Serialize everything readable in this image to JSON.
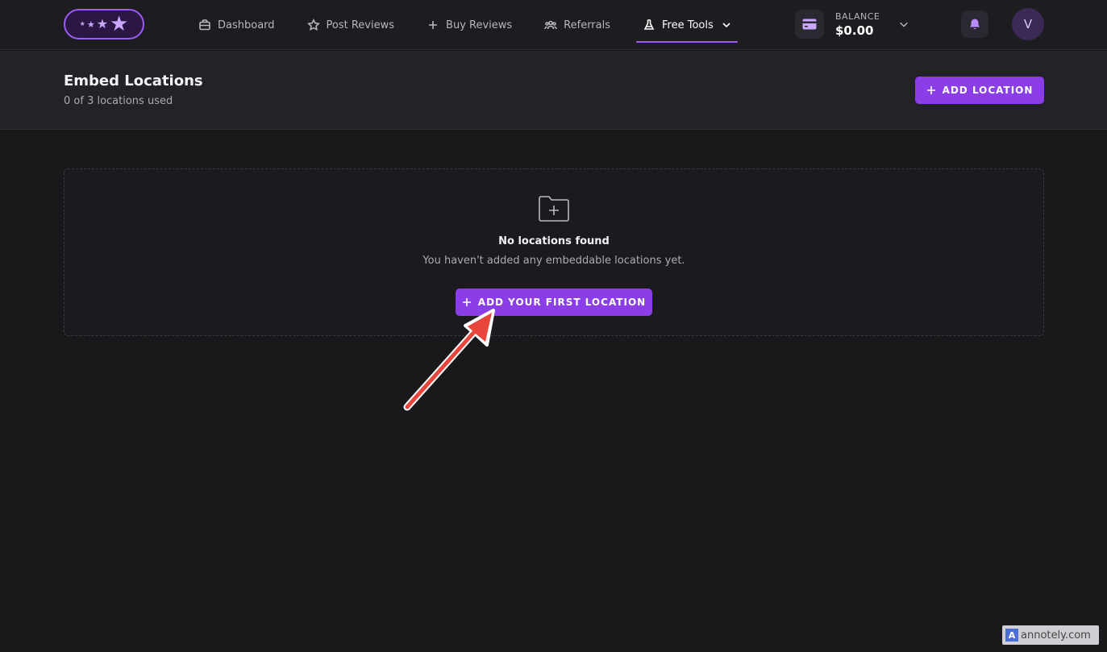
{
  "nav": {
    "items": [
      {
        "label": "Dashboard",
        "icon": "briefcase-icon"
      },
      {
        "label": "Post Reviews",
        "icon": "star-icon"
      },
      {
        "label": "Buy Reviews",
        "icon": "plus-icon"
      },
      {
        "label": "Referrals",
        "icon": "users-icon"
      },
      {
        "label": "Free Tools",
        "icon": "flask-icon"
      }
    ],
    "active": "Free Tools"
  },
  "balance": {
    "label": "BALANCE",
    "value": "$0.00"
  },
  "user": {
    "initial": "V"
  },
  "header": {
    "title": "Embed Locations",
    "subtitle": "0 of 3 locations used",
    "add_button": "ADD LOCATION"
  },
  "empty_state": {
    "title": "No locations found",
    "message": "You haven't added any embeddable locations yet.",
    "button": "ADD YOUR FIRST LOCATION"
  },
  "watermark": {
    "text": "annotely.com"
  },
  "colors": {
    "accent": "#8b3ee8",
    "background": "#19181b",
    "arrow": "#e8453c"
  }
}
